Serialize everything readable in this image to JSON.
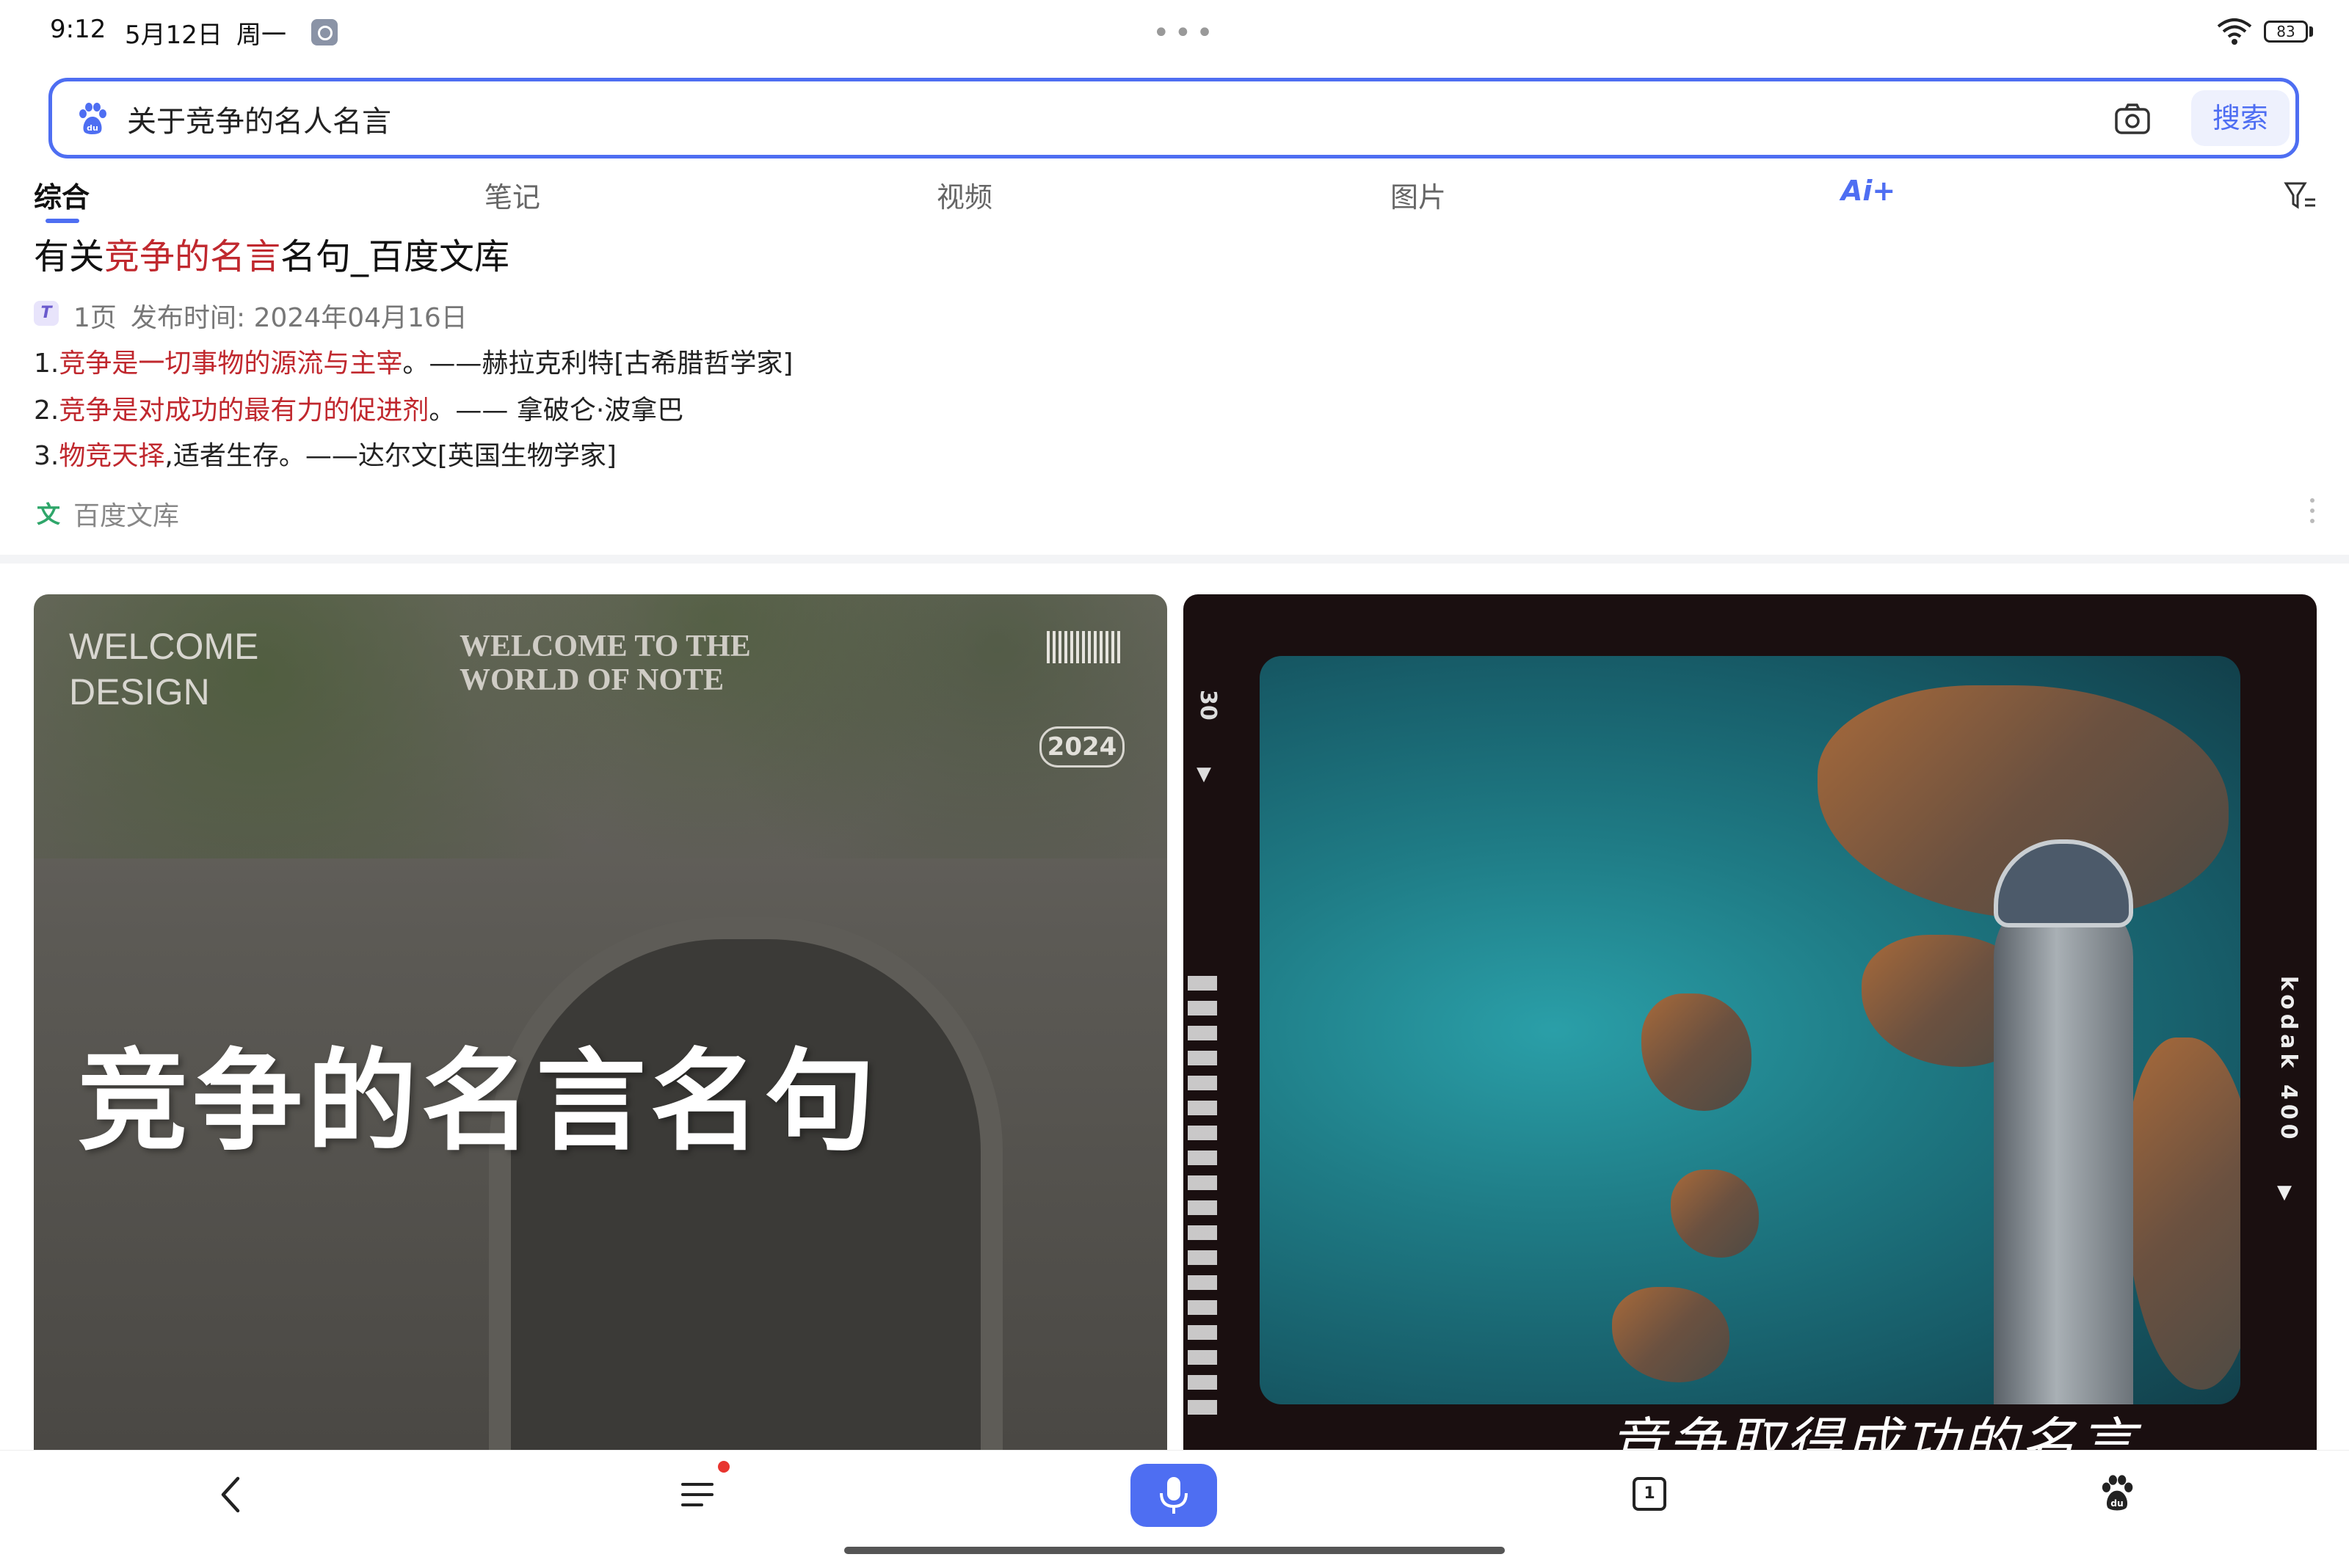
{
  "status_bar": {
    "time": "9:12",
    "date": "5月12日",
    "weekday": "周一",
    "battery": "83"
  },
  "search": {
    "query": "关于竞争的名人名言",
    "button_label": "搜索"
  },
  "tabs": [
    {
      "label": "综合",
      "active": true
    },
    {
      "label": "笔记"
    },
    {
      "label": "视频"
    },
    {
      "label": "图片"
    },
    {
      "label": "Ai+"
    }
  ],
  "result": {
    "title_prefix": "有关",
    "title_highlight": "竞争的名言",
    "title_suffix": "名句_百度文库",
    "doc_type_icon": "T",
    "pages": "1页",
    "publish_date": "发布时间: 2024年04月16日",
    "quotes": [
      {
        "prefix": "1.",
        "highlight": "竞争是一切事物的源流与主宰",
        "suffix": "。——赫拉克利特[古希腊哲学家]"
      },
      {
        "prefix": "2.",
        "highlight": "竞争是对成功的最有力的促进剂",
        "suffix": "。—— 拿破仑·波拿巴"
      },
      {
        "prefix": "3.",
        "highlight": "物竞天择",
        "suffix": ",适者生存。——达尔文[英国生物学家]"
      }
    ],
    "source_icon": "文",
    "source": "百度文库"
  },
  "image_cards": {
    "left": {
      "welcome_design": "WELCOME\nDESIGN",
      "welcome_world": "WELCOME TO THE\nWORLD OF NOTE",
      "year": "2024",
      "title": "竞争的名言名句"
    },
    "right": {
      "film_number": "30",
      "film_brand": "kodak 400",
      "title": "竞争取得成功的名言"
    }
  },
  "bottom_nav": {
    "tab_count": "1"
  },
  "colors": {
    "accent": "#4e6ef2",
    "highlight_red": "#c0282e",
    "notification_dot": "#e8352f"
  }
}
